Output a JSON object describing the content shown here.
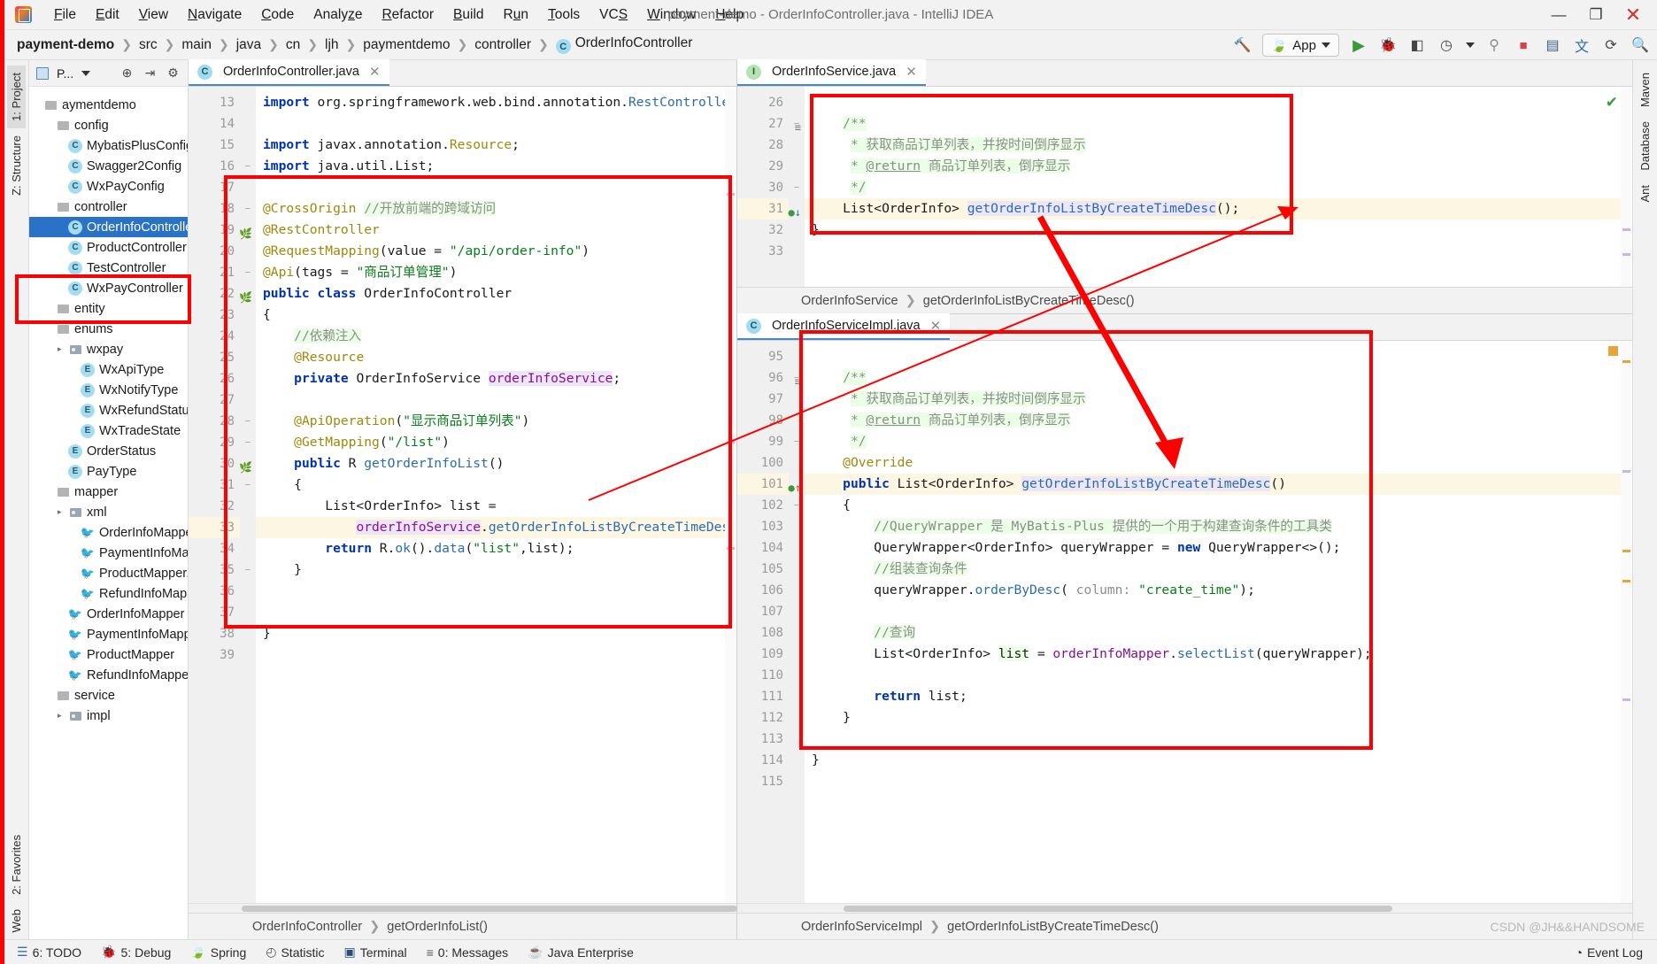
{
  "window": {
    "title": "payment-demo - OrderInfoController.java - IntelliJ IDEA",
    "minimize": "—",
    "maximize": "❐",
    "close": "✕"
  },
  "menu": [
    {
      "label": "File"
    },
    {
      "label": "Edit"
    },
    {
      "label": "View"
    },
    {
      "label": "Navigate"
    },
    {
      "label": "Code"
    },
    {
      "label": "Analyze"
    },
    {
      "label": "Refactor"
    },
    {
      "label": "Build"
    },
    {
      "label": "Run"
    },
    {
      "label": "Tools"
    },
    {
      "label": "VCS"
    },
    {
      "label": "Window"
    },
    {
      "label": "Help"
    }
  ],
  "navbar": {
    "crumbs": [
      "payment-demo",
      "src",
      "main",
      "java",
      "cn",
      "ljh",
      "paymentdemo",
      "controller",
      "OrderInfoController"
    ],
    "last_badge": "C",
    "run_config": "App",
    "icons": [
      "build-hammer-icon",
      "run-icon",
      "debug-icon",
      "run-with-coverage-icon",
      "profiler-icon",
      "attach-icon",
      "stop-icon",
      "update-icon",
      "translate-icon",
      "layout-icon",
      "search-icon"
    ]
  },
  "left_strip": {
    "tabs": [
      "1: Project",
      "Z: Structure",
      "2: Favorites",
      "Web"
    ]
  },
  "right_strip": {
    "tabs": [
      "Maven",
      "Database",
      "Ant"
    ]
  },
  "project_panel": {
    "title": "P...",
    "icons": [
      "target-icon",
      "collapse-icon",
      "settings-gear-icon"
    ],
    "tree": [
      {
        "label": "aymentdemo",
        "indent": 0,
        "icon": "folder",
        "arrow": ""
      },
      {
        "label": "config",
        "indent": 1,
        "icon": "folder",
        "arrow": ""
      },
      {
        "label": "MybatisPlusConfig",
        "indent": 2,
        "icon": "class",
        "arrow": ""
      },
      {
        "label": "Swagger2Config",
        "indent": 2,
        "icon": "class",
        "arrow": ""
      },
      {
        "label": "WxPayConfig",
        "indent": 2,
        "icon": "class",
        "arrow": ""
      },
      {
        "label": "controller",
        "indent": 1,
        "icon": "folder",
        "arrow": ""
      },
      {
        "label": "OrderInfoController",
        "indent": 2,
        "icon": "class",
        "arrow": "",
        "selected": true
      },
      {
        "label": "ProductController",
        "indent": 2,
        "icon": "class",
        "arrow": ""
      },
      {
        "label": "TestController",
        "indent": 2,
        "icon": "class",
        "arrow": ""
      },
      {
        "label": "WxPayController",
        "indent": 2,
        "icon": "class",
        "arrow": ""
      },
      {
        "label": "entity",
        "indent": 1,
        "icon": "folder",
        "arrow": ""
      },
      {
        "label": "enums",
        "indent": 1,
        "icon": "folder",
        "arrow": ""
      },
      {
        "label": "wxpay",
        "indent": 2,
        "icon": "folder-blue",
        "arrow": "▸"
      },
      {
        "label": "WxApiType",
        "indent": 3,
        "icon": "enum",
        "arrow": ""
      },
      {
        "label": "WxNotifyType",
        "indent": 3,
        "icon": "enum",
        "arrow": ""
      },
      {
        "label": "WxRefundStatus",
        "indent": 3,
        "icon": "enum",
        "arrow": ""
      },
      {
        "label": "WxTradeState",
        "indent": 3,
        "icon": "enum",
        "arrow": ""
      },
      {
        "label": "OrderStatus",
        "indent": 2,
        "icon": "enum",
        "arrow": ""
      },
      {
        "label": "PayType",
        "indent": 2,
        "icon": "enum",
        "arrow": ""
      },
      {
        "label": "mapper",
        "indent": 1,
        "icon": "folder",
        "arrow": ""
      },
      {
        "label": "xml",
        "indent": 2,
        "icon": "folder-blue",
        "arrow": "▸"
      },
      {
        "label": "OrderInfoMapper.",
        "indent": 3,
        "icon": "xml",
        "arrow": ""
      },
      {
        "label": "PaymentInfoMapp",
        "indent": 3,
        "icon": "xml",
        "arrow": ""
      },
      {
        "label": "ProductMapper.xm",
        "indent": 3,
        "icon": "xml",
        "arrow": ""
      },
      {
        "label": "RefundInfoMappe",
        "indent": 3,
        "icon": "xml",
        "arrow": ""
      },
      {
        "label": "OrderInfoMapper",
        "indent": 2,
        "icon": "xml",
        "arrow": ""
      },
      {
        "label": "PaymentInfoMapper",
        "indent": 2,
        "icon": "xml",
        "arrow": ""
      },
      {
        "label": "ProductMapper",
        "indent": 2,
        "icon": "xml",
        "arrow": ""
      },
      {
        "label": "RefundInfoMapper",
        "indent": 2,
        "icon": "xml",
        "arrow": ""
      },
      {
        "label": "service",
        "indent": 1,
        "icon": "folder",
        "arrow": ""
      },
      {
        "label": "impl",
        "indent": 2,
        "icon": "folder-blue",
        "arrow": "▸"
      }
    ]
  },
  "editor_left": {
    "tab": {
      "label": "OrderInfoController.java",
      "badge": "C",
      "close": "✕"
    },
    "breadcrumb": [
      "OrderInfoController",
      "getOrderInfoList()"
    ],
    "first_line": 13,
    "lines": [
      {
        "n": 13,
        "html": "<span class=\"kw\">import</span> org.springframework.web.bind.annotation.<span class=\"mth\">RestController</span>;",
        "clipped": true
      },
      {
        "n": 14,
        "html": ""
      },
      {
        "n": 15,
        "html": "<span class=\"kw\">import</span> javax.annotation.<span class=\"anno\">Resource</span>;"
      },
      {
        "n": 16,
        "html": "<span class=\"kw\">import</span> java.util.List;",
        "fold": "−"
      },
      {
        "n": 17,
        "html": ""
      },
      {
        "n": 18,
        "html": "<span class=\"anno\">@CrossOrigin</span> <span class=\"cmt\">//开放前端的跨域访问</span>",
        "fold": "−"
      },
      {
        "n": 19,
        "html": "<span class=\"anno\">@RestController</span>",
        "gmark": "bean"
      },
      {
        "n": 20,
        "html": "<span class=\"anno\">@RequestMapping</span>(value = <span class=\"str\">\"/api/order-info\"</span>)"
      },
      {
        "n": 21,
        "html": "<span class=\"anno\">@Api</span>(tags = <span class=\"str\">\"商品订单管理\"</span>)",
        "fold": "−"
      },
      {
        "n": 22,
        "html": "<span class=\"kw\">public class</span> OrderInfoController",
        "gmark": "bean"
      },
      {
        "n": 23,
        "html": "{"
      },
      {
        "n": 24,
        "html": "    <span class=\"cmt\">//依赖注入</span>"
      },
      {
        "n": 25,
        "html": "    <span class=\"anno\">@Resource</span>"
      },
      {
        "n": 26,
        "html": "    <span class=\"kw\">private</span> OrderInfoService <span class=\"fld hl-purple\">orderInfoService</span>;"
      },
      {
        "n": 27,
        "html": ""
      },
      {
        "n": 28,
        "html": "    <span class=\"anno\">@ApiOperation</span>(<span class=\"str\">\"显示商品订单列表\"</span>)",
        "fold": "−"
      },
      {
        "n": 29,
        "html": "    <span class=\"anno\">@GetMapping</span>(<span class=\"str\">\"/list\"</span>)",
        "fold": "−"
      },
      {
        "n": 30,
        "html": "    <span class=\"kw\">public</span> R <span class=\"mth\">getOrderInfoList</span>()",
        "gmark": "bean"
      },
      {
        "n": 31,
        "html": "    {",
        "fold": "−"
      },
      {
        "n": 32,
        "html": "        List&lt;OrderInfo&gt; list ="
      },
      {
        "n": 33,
        "html": "            <span class=\"fld hl-purple\">orderInfoService</span>.<span class=\"mth\">getOrderInfoListByCreateTimeDesc</span>();",
        "cur": true
      },
      {
        "n": 34,
        "html": "        <span class=\"kw\">return</span> R.<span class=\"mth\">ok</span>().<span class=\"mth\">data</span>(<span class=\"str\">\"list\"</span>,list);"
      },
      {
        "n": 35,
        "html": "    }",
        "fold": "−"
      },
      {
        "n": 36,
        "html": ""
      },
      {
        "n": 37,
        "html": ""
      },
      {
        "n": 38,
        "html": "}"
      },
      {
        "n": 39,
        "html": ""
      }
    ]
  },
  "editor_service": {
    "tab": {
      "label": "OrderInfoService.java",
      "badge": "I",
      "close": "✕"
    },
    "breadcrumb": [
      "OrderInfoService",
      "getOrderInfoListByCreateTimeDesc()"
    ],
    "lines": [
      {
        "n": 26,
        "html": "",
        "clipped": true
      },
      {
        "n": 27,
        "html": "    <span class=\"cmt\">/**</span>",
        "fold": "−",
        "gmark": "struct"
      },
      {
        "n": 28,
        "html": "     <span class=\"cmt\">* 获取商品订单列表，并按时间倒序显示</span>"
      },
      {
        "n": 29,
        "html": "     <span class=\"cmt\">* <span class=\"ul\">@return</span> 商品订单列表，倒序显示</span>"
      },
      {
        "n": 30,
        "html": "     <span class=\"cmt\">*/</span>",
        "fold": "−"
      },
      {
        "n": 31,
        "html": "    List&lt;OrderInfo&gt; <span class=\"mth hl-purple\">getOrderInfoListByCreateTimeDesc</span>();",
        "cur": true,
        "gmark": "impl-down"
      },
      {
        "n": 32,
        "html": "}"
      },
      {
        "n": 33,
        "html": ""
      }
    ]
  },
  "editor_impl": {
    "tab": {
      "label": "OrderInfoServiceImpl.java",
      "badge": "C",
      "close": "✕"
    },
    "breadcrumb": [
      "OrderInfoServiceImpl",
      "getOrderInfoListByCreateTimeDesc()"
    ],
    "lines": [
      {
        "n": 95,
        "html": ""
      },
      {
        "n": 96,
        "html": "    <span class=\"cmt\">/**</span>",
        "fold": "−",
        "gmark": "struct"
      },
      {
        "n": 97,
        "html": "     <span class=\"cmt\">* 获取商品订单列表，并按时间倒序显示</span>"
      },
      {
        "n": 98,
        "html": "     <span class=\"cmt\">* <span class=\"ul\">@return</span> 商品订单列表，倒序显示</span>"
      },
      {
        "n": 99,
        "html": "     <span class=\"cmt\">*/</span>",
        "fold": "−"
      },
      {
        "n": 100,
        "html": "    <span class=\"anno\">@Override</span>"
      },
      {
        "n": 101,
        "html": "    <span class=\"kw\">public</span> List&lt;OrderInfo&gt; <span class=\"mth hl-purple\">getOrderInfoListByCreateTimeDesc</span>()",
        "cur": true,
        "gmark": "impl-up"
      },
      {
        "n": 102,
        "html": "    {",
        "fold": "−"
      },
      {
        "n": 103,
        "html": "        <span class=\"cmt\">//QueryWrapper 是 MyBatis-Plus 提供的一个用于构建查询条件的工具类</span>"
      },
      {
        "n": 104,
        "html": "        QueryWrapper&lt;OrderInfo&gt; queryWrapper = <span class=\"kw\">new</span> QueryWrapper&lt;&gt;();"
      },
      {
        "n": 105,
        "html": "        <span class=\"cmt\">//组装查询条件</span>"
      },
      {
        "n": 106,
        "html": "        queryWrapper.<span class=\"mth\">orderByDesc</span>( <span class=\"cmt2\">column:</span> <span class=\"str\">\"create_time\"</span>);"
      },
      {
        "n": 107,
        "html": ""
      },
      {
        "n": 108,
        "html": "        <span class=\"cmt\">//查询</span>"
      },
      {
        "n": 109,
        "html": "        List&lt;OrderInfo&gt; <span class=\"hl-green\">list</span> = <span class=\"fld\">orderInfoMapper</span>.<span class=\"mth\">selectList</span>(queryWrapper);"
      },
      {
        "n": 110,
        "html": ""
      },
      {
        "n": 111,
        "html": "        <span class=\"kw\">return</span> list;"
      },
      {
        "n": 112,
        "html": "    }"
      },
      {
        "n": 113,
        "html": ""
      },
      {
        "n": 114,
        "html": "}"
      },
      {
        "n": 115,
        "html": ""
      }
    ]
  },
  "statusbar": {
    "items": [
      {
        "label": "6: TODO",
        "icon": "todo-icon"
      },
      {
        "label": "5: Debug",
        "icon": "debug-icon"
      },
      {
        "label": "Spring",
        "icon": "spring-icon"
      },
      {
        "label": "Statistic",
        "icon": "statistic-icon"
      },
      {
        "label": "Terminal",
        "icon": "terminal-icon"
      },
      {
        "label": "0: Messages",
        "icon": "messages-icon"
      },
      {
        "label": "Java Enterprise",
        "icon": "java-icon"
      }
    ],
    "right": {
      "label": "Event Log",
      "icon": "event-log-icon"
    }
  },
  "watermark": "CSDN @JH&&HANDSOME",
  "colors": {
    "annotation_red": "#ff0000",
    "selection_blue": "#2a72c8",
    "comment_green_bg": "#eaffe5",
    "caret_row": "#fdf6e3",
    "accent": "#4a87c9"
  }
}
